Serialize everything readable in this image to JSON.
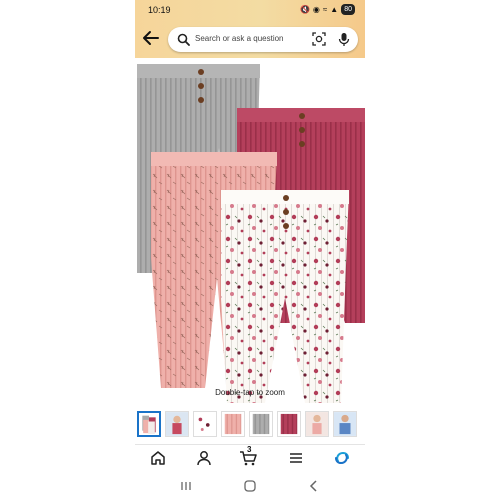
{
  "status_bar": {
    "time": "10:19",
    "battery": "80"
  },
  "header": {
    "search_placeholder": "Search or ask a question"
  },
  "product": {
    "zoom_hint": "Double-tap to zoom",
    "colors": {
      "gray": "#a9a9a9",
      "berry": "#b23d58",
      "pink": "#ecaaa5",
      "cream": "#fbf8f4",
      "button": "#6b3e22"
    }
  },
  "thumbnails": [
    "set-of-four",
    "baby-outfit",
    "floral-print",
    "pink-ribbed",
    "gray-ribbed",
    "berry-ribbed",
    "pink-pants-baby",
    "blue-outfit-baby"
  ],
  "bottom_nav": {
    "cart_count": "3"
  },
  "accent": "#1a73c8"
}
